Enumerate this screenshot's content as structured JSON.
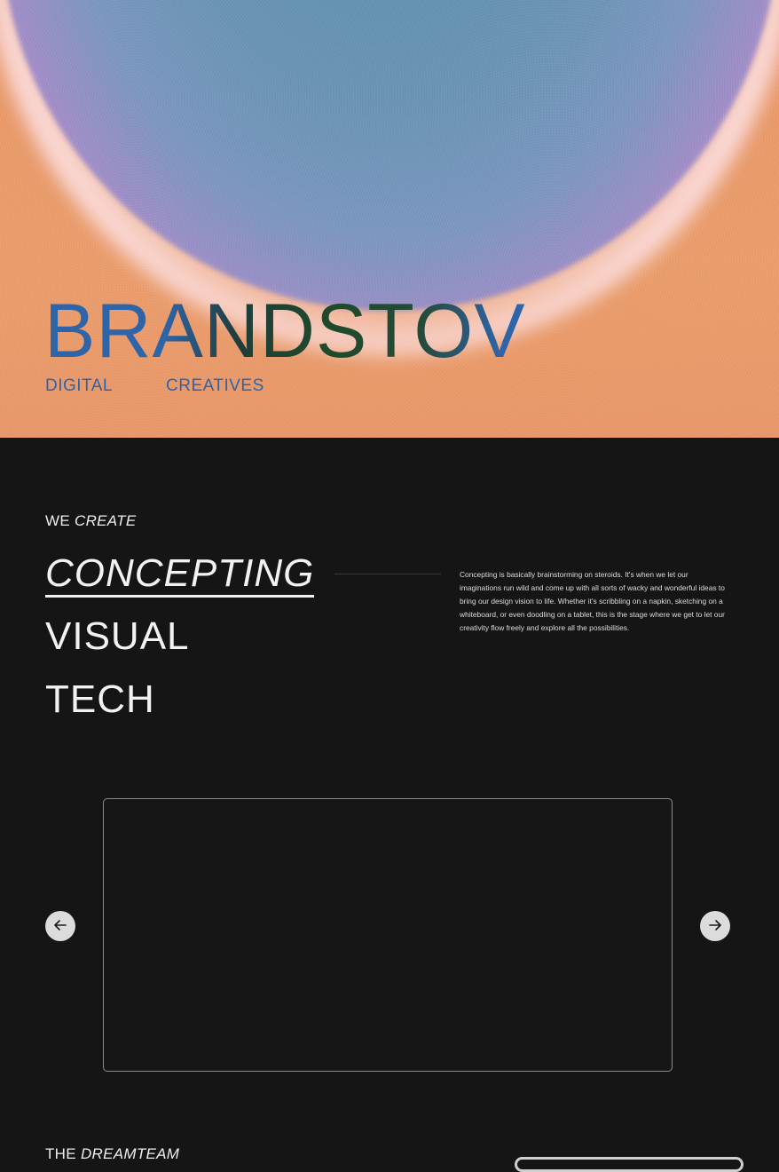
{
  "hero": {
    "title": "BRANDSTOV",
    "subtitle_left": "DIGITAL",
    "subtitle_right": "CREATIVES"
  },
  "services_section": {
    "label_plain": "WE",
    "label_italic": "CREATE",
    "items": [
      {
        "label": "CONCEPTING",
        "active": true
      },
      {
        "label": "VISUAL",
        "active": false
      },
      {
        "label": "TECH",
        "active": false
      }
    ],
    "description": "Concepting is basically brainstorming on steroids. It's when we let our imaginations run wild and come up with all sorts of wacky and wonderful ideas to bring our design vision to life. Whether it's scribbling on a napkin, sketching on a whiteboard, or even doodling on a tablet, this is the stage where we get to let our creativity flow freely and explore all the possibilities."
  },
  "carousel": {
    "prev_icon": "arrow-left-icon",
    "next_icon": "arrow-right-icon"
  },
  "team_section": {
    "label_plain": "THE",
    "label_italic": "DREAMTEAM"
  },
  "colors": {
    "brand_blue": "#2f63a8",
    "background": "#151515",
    "text": "#f2f2f2"
  }
}
